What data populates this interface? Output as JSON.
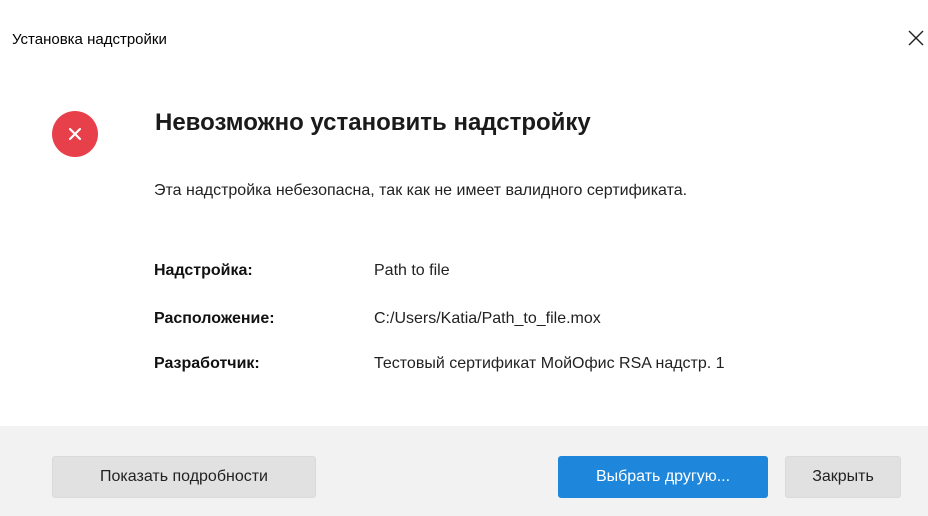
{
  "window": {
    "title": "Установка надстройки"
  },
  "icons": {
    "close": "close-icon",
    "error": "error-x-icon"
  },
  "colors": {
    "error_red": "#e8404a",
    "primary_blue": "#1f87db",
    "footer_bg": "#f2f2f2"
  },
  "content": {
    "heading": "Невозможно установить надстройку",
    "message": "Эта надстройка небезопасна, так как не имеет валидного сертификата.",
    "details": [
      {
        "label": "Надстройка:",
        "value": "Path to file"
      },
      {
        "label": "Расположение:",
        "value": "C:/Users/Katia/Path_to_file.mox"
      },
      {
        "label": "Разработчик:",
        "value": "Тестовый сертификат МойОфис RSA надстр. 1"
      }
    ]
  },
  "footer": {
    "details_button": "Показать подробности",
    "choose_button": "Выбрать другую...",
    "close_button": "Закрыть"
  }
}
